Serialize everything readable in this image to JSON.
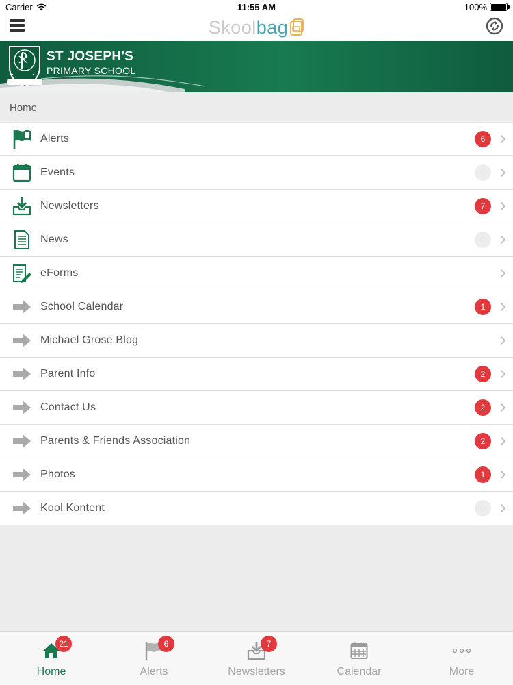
{
  "status_bar": {
    "carrier": "Carrier",
    "time": "11:55 AM",
    "battery": "100%"
  },
  "nav_bar": {
    "brand_part1": "Skool",
    "brand_part2": "bag"
  },
  "school": {
    "name_line1": "ST JOSEPH'S",
    "name_line2": "PRIMARY SCHOOL"
  },
  "breadcrumb": "Home",
  "menu": [
    {
      "label": "Alerts",
      "icon": "flag-icon",
      "badge": "6"
    },
    {
      "label": "Events",
      "icon": "calendar-icon",
      "badge": "0"
    },
    {
      "label": "Newsletters",
      "icon": "inbox-download-icon",
      "badge": "7"
    },
    {
      "label": "News",
      "icon": "document-icon",
      "badge": "0"
    },
    {
      "label": "eForms",
      "icon": "form-pen-icon",
      "badge": ""
    },
    {
      "label": "School Calendar",
      "icon": "arrow-right-icon",
      "badge": "1"
    },
    {
      "label": "Michael Grose Blog",
      "icon": "arrow-right-icon",
      "badge": ""
    },
    {
      "label": "Parent Info",
      "icon": "arrow-right-icon",
      "badge": "2"
    },
    {
      "label": "Contact Us",
      "icon": "arrow-right-icon",
      "badge": "2"
    },
    {
      "label": "Parents & Friends Association",
      "icon": "arrow-right-icon",
      "badge": "2"
    },
    {
      "label": "Photos",
      "icon": "arrow-right-icon",
      "badge": "1"
    },
    {
      "label": "Kool Kontent",
      "icon": "arrow-right-icon",
      "badge": "0"
    }
  ],
  "tabs": [
    {
      "label": "Home",
      "icon": "home-icon",
      "badge": "21",
      "active": true
    },
    {
      "label": "Alerts",
      "icon": "flag-icon",
      "badge": "6",
      "active": false
    },
    {
      "label": "Newsletters",
      "icon": "inbox-download-icon",
      "badge": "7",
      "active": false
    },
    {
      "label": "Calendar",
      "icon": "calendar-grid-icon",
      "badge": "",
      "active": false
    },
    {
      "label": "More",
      "icon": "more-dots-icon",
      "badge": "",
      "active": false
    }
  ],
  "colors": {
    "brand_green": "#1a7a4f",
    "badge_red": "#e03a3e",
    "brand_teal": "#3fa6b5",
    "header_green": "#0f5c3e"
  }
}
